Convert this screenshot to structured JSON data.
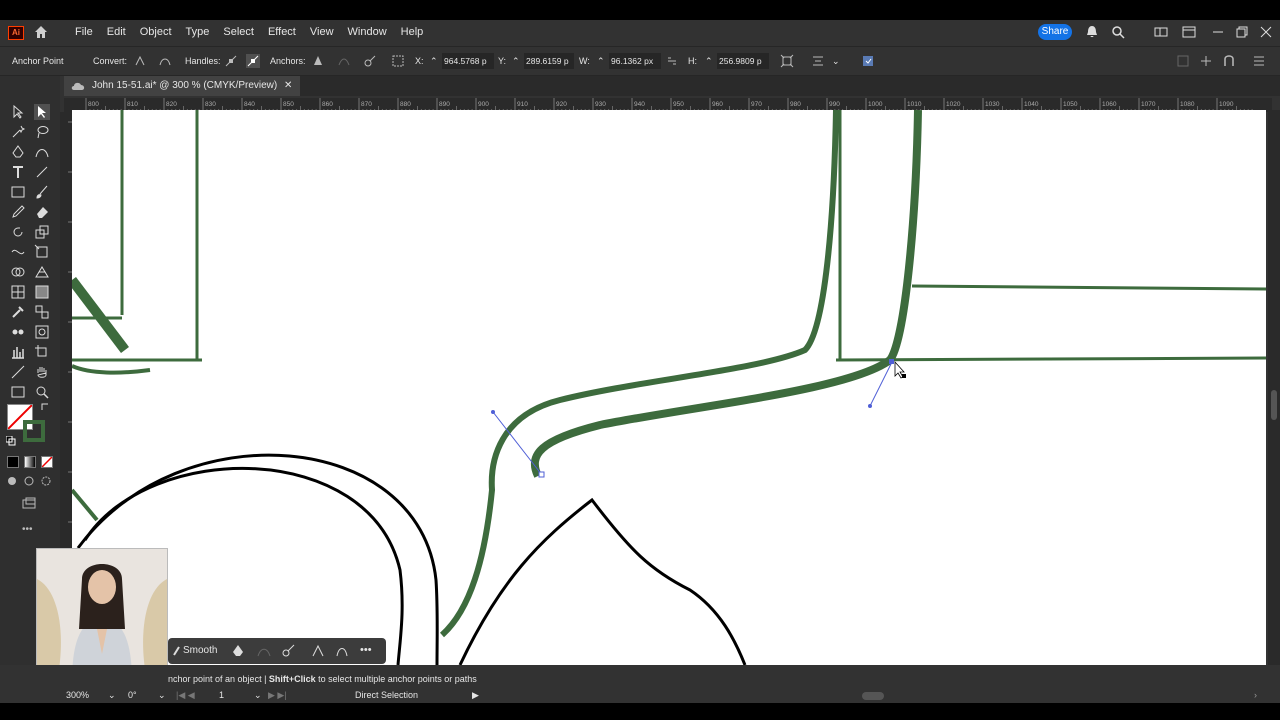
{
  "menubar": {
    "logo": "Ai",
    "items": [
      "File",
      "Edit",
      "Object",
      "Type",
      "Select",
      "Effect",
      "View",
      "Window",
      "Help"
    ],
    "share_label": "Share"
  },
  "controlbar": {
    "tool_name": "Anchor Point",
    "convert_label": "Convert:",
    "handles_label": "Handles:",
    "anchors_label": "Anchors:",
    "x_label": "X:",
    "x_value": "964.5768 p",
    "y_label": "Y:",
    "y_value": "289.6159 p",
    "w_label": "W:",
    "w_value": "96.1362 px",
    "h_label": "H:",
    "h_value": "256.9809 p"
  },
  "document_tab": {
    "title": "John 15-51.ai* @ 300 % (CMYK/Preview)",
    "close": "✕"
  },
  "ruler": {
    "ticks": [
      "800",
      "810",
      "820",
      "830",
      "840",
      "850",
      "860",
      "870",
      "880",
      "890",
      "900",
      "910",
      "920",
      "930",
      "940",
      "950",
      "960",
      "970",
      "980",
      "990",
      "1000",
      "1010",
      "1020",
      "1030",
      "1040",
      "1050",
      "1060",
      "1070",
      "1080",
      "1090"
    ]
  },
  "context_bar": {
    "smooth_label": "Smooth",
    "more": "•••"
  },
  "status": {
    "hint_part1": "nchor point of an object  |  ",
    "hint_bold": "Shift+Click",
    "hint_part2": " to select multiple anchor points or paths",
    "zoom": "300%",
    "rotation": "0°",
    "artboard": "1",
    "tool": "Direct Selection"
  },
  "colors": {
    "accent": "#1473e6",
    "path_green": "#3d6b3d",
    "selection": "#4f5fd6"
  }
}
